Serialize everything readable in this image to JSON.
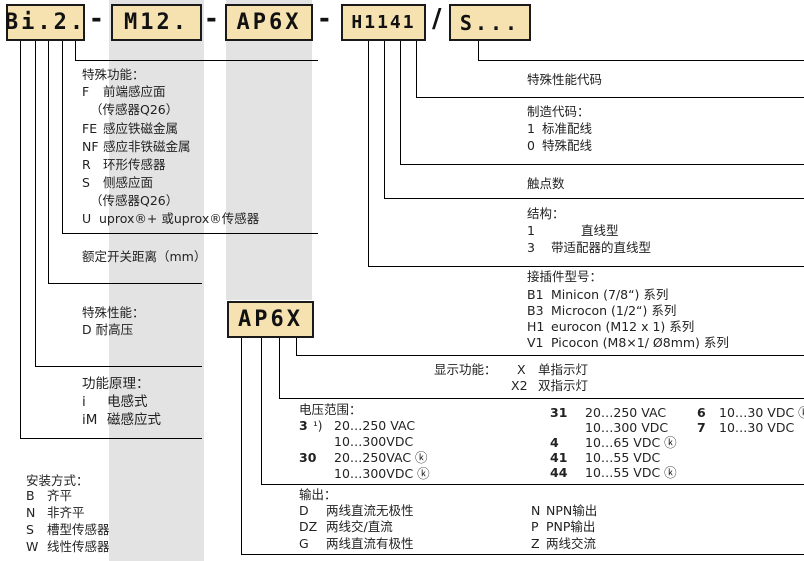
{
  "code": {
    "bi": "Bi.2.",
    "sep1": "-",
    "m12": "M12.",
    "sep2": "-",
    "ap6x": "AP6X",
    "sep3": "-",
    "h1141": "H1141",
    "sep4": "/",
    "s": "S..."
  },
  "colors": {
    "code_box_fill": "#f5e2b0",
    "shade_band": "#e3e3e3",
    "line": "#000000"
  },
  "special_function": {
    "title": "特殊功能：",
    "items": [
      {
        "code": "F",
        "text": "前端感应面",
        "sub": "（传感器Q26）"
      },
      {
        "code": "FE",
        "text": "感应铁磁金属"
      },
      {
        "code": "NF",
        "text": "感应非铁磁金属"
      },
      {
        "code": "R",
        "text": "环形传感器"
      },
      {
        "code": "S",
        "text": "侧感应面",
        "sub": "（传感器Q26）"
      },
      {
        "code": "U",
        "text": "uprox®+ 或uprox®传感器"
      }
    ]
  },
  "rated_distance": "额定开关距离（mm）",
  "special_property": {
    "title": "特殊性能：",
    "item": "D 耐高压"
  },
  "principle": {
    "title": "功能原理：",
    "items": [
      {
        "code": "i",
        "text": "电感式"
      },
      {
        "code": "iM",
        "text": "磁感应式"
      }
    ]
  },
  "mounting": {
    "title": "安装方式：",
    "items": [
      {
        "code": "B",
        "text": "齐平"
      },
      {
        "code": "N",
        "text": "非齐平"
      },
      {
        "code": "S",
        "text": "槽型传感器"
      },
      {
        "code": "W",
        "text": "线性传感器"
      }
    ]
  },
  "special_property_code": "特殊性能代码",
  "manufacture_code": {
    "title": "制造代码：",
    "items": [
      {
        "code": "1",
        "text": "标准配线"
      },
      {
        "code": "0",
        "text": "特殊配线"
      }
    ]
  },
  "contact_count": "触点数",
  "structure": {
    "title": "结构：",
    "items": [
      {
        "code": "1",
        "text": "直线型"
      },
      {
        "code": "3",
        "text": "带适配器的直线型"
      }
    ]
  },
  "connector": {
    "title": "接插件型号：",
    "items": [
      {
        "code": "B1",
        "text": "Minicon (7/8“) 系列"
      },
      {
        "code": "B3",
        "text": "Microcon (1/2“) 系列"
      },
      {
        "code": "H1",
        "text": "eurocon  (M12 x 1) 系列"
      },
      {
        "code": "V1",
        "text": "Picocon  (M8×1/ Ø8mm) 系列"
      }
    ]
  },
  "display_function": {
    "title": "显示功能：",
    "items": [
      {
        "code": "X",
        "text": "单指示灯"
      },
      {
        "code": "X2",
        "text": "双指示灯"
      }
    ]
  },
  "voltage": {
    "title": "电压范围：",
    "items": [
      {
        "code": "3",
        "note": "¹)",
        "text": "20…250 VAC",
        "text2": "10…300VDC"
      },
      {
        "code": "30",
        "text": "20…250VAC ⓚ",
        "text2": "10…300VDC ⓚ"
      },
      {
        "code": "31",
        "text": "20…250 VAC",
        "text2": "10…300 VDC"
      },
      {
        "code": "4",
        "text": "10…65 VDC ⓚ"
      },
      {
        "code": "41",
        "text": "10…55 VDC"
      },
      {
        "code": "44",
        "text": "10…55 VDC ⓚ"
      },
      {
        "code": "6",
        "text": "10…30 VDC ⓚ"
      },
      {
        "code": "7",
        "text": "10…30 VDC"
      }
    ]
  },
  "output": {
    "title": "输出：",
    "items": [
      {
        "code": "D",
        "text": "两线直流无极性"
      },
      {
        "code": "DZ",
        "text": "两线交/直流"
      },
      {
        "code": "G",
        "text": "两线直流有极性"
      },
      {
        "code": "N",
        "text": "NPN输出"
      },
      {
        "code": "P",
        "text": "PNP输出"
      },
      {
        "code": "Z",
        "text": "两线交流"
      }
    ]
  }
}
